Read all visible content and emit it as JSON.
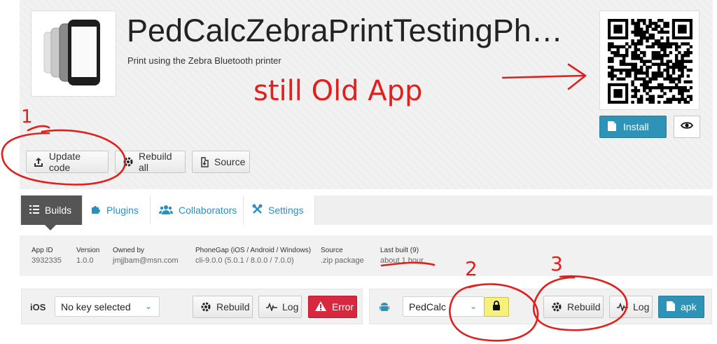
{
  "app": {
    "title": "PedCalcZebraPrintTestingPh…",
    "subtitle": "Print using the Zebra Bluetooth printer"
  },
  "header_actions": {
    "install_label": "Install",
    "update_code_label": "Update code",
    "rebuild_all_label": "Rebuild all",
    "source_label": "Source"
  },
  "tabs": [
    {
      "label": "Builds",
      "active": true
    },
    {
      "label": "Plugins",
      "active": false
    },
    {
      "label": "Collaborators",
      "active": false
    },
    {
      "label": "Settings",
      "active": false
    }
  ],
  "meta": [
    {
      "key": "App ID",
      "value": "3932335"
    },
    {
      "key": "Version",
      "value": "1.0.0"
    },
    {
      "key": "Owned by",
      "value": "jmjjbam@msn.com"
    },
    {
      "key": "PhoneGap (iOS / Android / Windows)",
      "value": "cli-9.0.0 (5.0.1 / 8.0.0 / 7.0.0)"
    },
    {
      "key": "Source",
      "value": ".zip package"
    },
    {
      "key": "Last built (9)",
      "value": "about 1 hour"
    }
  ],
  "ios": {
    "label": "iOS",
    "key_select": "No key selected",
    "rebuild_label": "Rebuild",
    "log_label": "Log",
    "status_label": "Error"
  },
  "android": {
    "key_select": "PedCalc",
    "rebuild_label": "Rebuild",
    "log_label": "Log",
    "download_label": "apk"
  },
  "annotations": {
    "note": "still Old App",
    "mark_1": "1",
    "mark_2": "2",
    "mark_3": "3"
  },
  "colors": {
    "accent": "#2e93b6",
    "error": "#d7283f",
    "lock": "#f6f17b",
    "annotation": "#e0201c",
    "tab_active": "#555555"
  }
}
